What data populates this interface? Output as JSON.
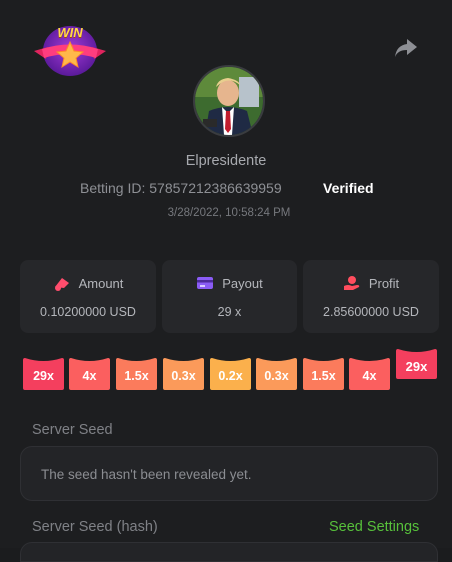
{
  "header": {
    "badge_text": "WIN",
    "badge_icon": "win-badge-icon",
    "share_icon": "share-icon"
  },
  "player": {
    "username": "Elpresidente",
    "betting_id_label": "Betting ID:",
    "betting_id": "57857212386639959",
    "verified_label": "Verified",
    "timestamp": "3/28/2022, 10:58:24 PM"
  },
  "stats": [
    {
      "icon": "chip-icon",
      "label": "Amount",
      "value": "0.10200000 USD",
      "icon_color": "#ff4d6d"
    },
    {
      "icon": "card-icon",
      "label": "Payout",
      "value": "29 x",
      "icon_color": "#8b5cf6"
    },
    {
      "icon": "hand-coin-icon",
      "label": "Profit",
      "value": "2.85600000 USD",
      "icon_color": "#ff4d5e"
    }
  ],
  "multipliers": [
    {
      "label": "29x",
      "color": "#f43f5e",
      "selected": false
    },
    {
      "label": "4x",
      "color": "#fb5f5f",
      "selected": false
    },
    {
      "label": "1.5x",
      "color": "#fb7b5c",
      "selected": false
    },
    {
      "label": "0.3x",
      "color": "#fb9a5a",
      "selected": false
    },
    {
      "label": "0.2x",
      "color": "#fbb04c",
      "selected": false
    },
    {
      "label": "0.3x",
      "color": "#fb9a5a",
      "selected": false
    },
    {
      "label": "1.5x",
      "color": "#fb7b5c",
      "selected": false
    },
    {
      "label": "4x",
      "color": "#fb5f5f",
      "selected": false
    },
    {
      "label": "29x",
      "color": "#f43f5e",
      "selected": true
    }
  ],
  "server_seed": {
    "label": "Server Seed",
    "value": "The seed hasn't been revealed yet."
  },
  "server_seed_hash": {
    "label": "Server Seed (hash)",
    "settings_link": "Seed Settings"
  },
  "colors": {
    "accent_green": "#57c03b",
    "background": "#1d1e20",
    "card": "#26272a"
  }
}
